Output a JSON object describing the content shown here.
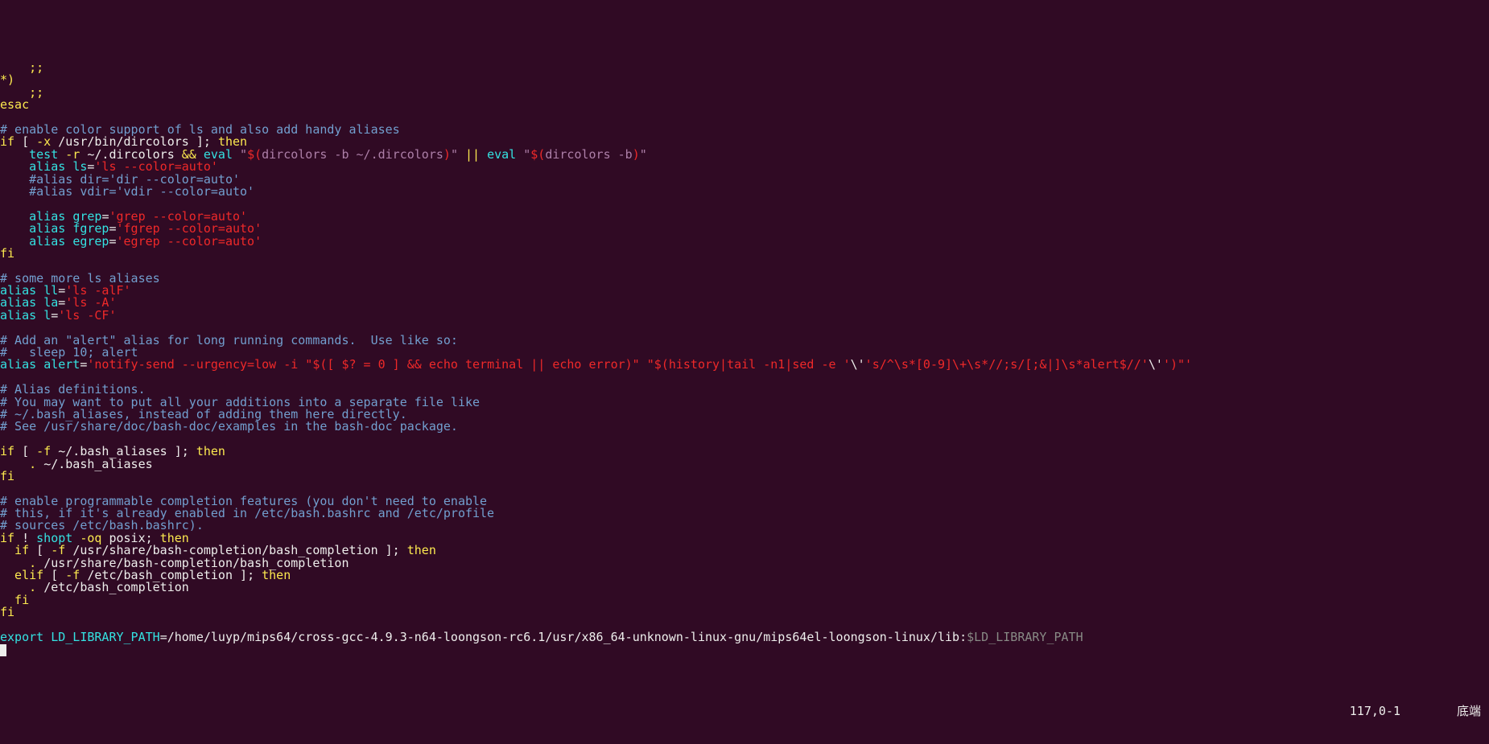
{
  "status": {
    "position": "117,0-1",
    "label": "底端"
  },
  "lines": [
    [
      {
        "t": "    ;;",
        "c": "c-kw"
      }
    ],
    [
      {
        "t": "*)",
        "c": "c-kw"
      }
    ],
    [
      {
        "t": "    ;;",
        "c": "c-kw"
      }
    ],
    [
      {
        "t": "esac",
        "c": "c-kw"
      }
    ],
    [
      {
        "t": "",
        "c": ""
      }
    ],
    [
      {
        "t": "# enable color support of ls and also add handy aliases",
        "c": "c-cmt"
      }
    ],
    [
      {
        "t": "if",
        "c": "c-kw"
      },
      {
        "t": " [ ",
        "c": "c-white"
      },
      {
        "t": "-x ",
        "c": "c-kw"
      },
      {
        "t": "/usr/bin/dircolors",
        "c": "c-white"
      },
      {
        "t": " ]",
        "c": "c-white"
      },
      {
        "t": "; ",
        "c": "c-white"
      },
      {
        "t": "then",
        "c": "c-kw"
      }
    ],
    [
      {
        "t": "    test ",
        "c": "c-cmd"
      },
      {
        "t": "-r ",
        "c": "c-kw"
      },
      {
        "t": "~/.dircolors ",
        "c": "c-white"
      },
      {
        "t": "&& ",
        "c": "c-kw"
      },
      {
        "t": "eval ",
        "c": "c-cmd"
      },
      {
        "t": "\"",
        "c": "c-str"
      },
      {
        "t": "$(",
        "c": "c-red"
      },
      {
        "t": "dircolors -b ~/.dircolors",
        "c": "c-str"
      },
      {
        "t": ")",
        "c": "c-red"
      },
      {
        "t": "\"",
        "c": "c-str"
      },
      {
        "t": " || ",
        "c": "c-kw"
      },
      {
        "t": "eval ",
        "c": "c-cmd"
      },
      {
        "t": "\"",
        "c": "c-str"
      },
      {
        "t": "$(",
        "c": "c-red"
      },
      {
        "t": "dircolors -b",
        "c": "c-str"
      },
      {
        "t": ")",
        "c": "c-red"
      },
      {
        "t": "\"",
        "c": "c-str"
      }
    ],
    [
      {
        "t": "    alias ",
        "c": "c-cmd"
      },
      {
        "t": "ls",
        "c": "c-cmd"
      },
      {
        "t": "=",
        "c": "c-white"
      },
      {
        "t": "'ls --color=auto'",
        "c": "c-red"
      }
    ],
    [
      {
        "t": "    #alias dir='dir --color=auto'",
        "c": "c-cmt"
      }
    ],
    [
      {
        "t": "    #alias vdir='vdir --color=auto'",
        "c": "c-cmt"
      }
    ],
    [
      {
        "t": "",
        "c": ""
      }
    ],
    [
      {
        "t": "    alias ",
        "c": "c-cmd"
      },
      {
        "t": "grep",
        "c": "c-cmd"
      },
      {
        "t": "=",
        "c": "c-white"
      },
      {
        "t": "'grep --color=auto'",
        "c": "c-red"
      }
    ],
    [
      {
        "t": "    alias ",
        "c": "c-cmd"
      },
      {
        "t": "fgrep",
        "c": "c-cmd"
      },
      {
        "t": "=",
        "c": "c-white"
      },
      {
        "t": "'fgrep --color=auto'",
        "c": "c-red"
      }
    ],
    [
      {
        "t": "    alias ",
        "c": "c-cmd"
      },
      {
        "t": "egrep",
        "c": "c-cmd"
      },
      {
        "t": "=",
        "c": "c-white"
      },
      {
        "t": "'egrep --color=auto'",
        "c": "c-red"
      }
    ],
    [
      {
        "t": "fi",
        "c": "c-kw"
      }
    ],
    [
      {
        "t": "",
        "c": ""
      }
    ],
    [
      {
        "t": "# some more ls aliases",
        "c": "c-cmt"
      }
    ],
    [
      {
        "t": "alias ",
        "c": "c-cmd"
      },
      {
        "t": "ll",
        "c": "c-cmd"
      },
      {
        "t": "=",
        "c": "c-white"
      },
      {
        "t": "'ls -alF'",
        "c": "c-red"
      }
    ],
    [
      {
        "t": "alias ",
        "c": "c-cmd"
      },
      {
        "t": "la",
        "c": "c-cmd"
      },
      {
        "t": "=",
        "c": "c-white"
      },
      {
        "t": "'ls -A'",
        "c": "c-red"
      }
    ],
    [
      {
        "t": "alias ",
        "c": "c-cmd"
      },
      {
        "t": "l",
        "c": "c-cmd"
      },
      {
        "t": "=",
        "c": "c-white"
      },
      {
        "t": "'ls -CF'",
        "c": "c-red"
      }
    ],
    [
      {
        "t": "",
        "c": ""
      }
    ],
    [
      {
        "t": "# Add an \"alert\" alias for long running commands.  Use like so:",
        "c": "c-cmt"
      }
    ],
    [
      {
        "t": "#   sleep 10; alert",
        "c": "c-cmt"
      }
    ],
    [
      {
        "t": "alias ",
        "c": "c-cmd"
      },
      {
        "t": "alert",
        "c": "c-cmd"
      },
      {
        "t": "=",
        "c": "c-white"
      },
      {
        "t": "'notify-send --urgency=low -i \"$([ $? = 0 ] && echo terminal || echo error)\" \"$(history|tail -n1|sed -e ",
        "c": "c-red"
      },
      {
        "t": "'",
        "c": "c-red"
      },
      {
        "t": "\\'",
        "c": "c-white"
      },
      {
        "t": "'",
        "c": "c-red"
      },
      {
        "t": "s/^\\s*[0-9]\\+\\s*//;s/[;&|]\\s*alert$//",
        "c": "c-red"
      },
      {
        "t": "'",
        "c": "c-red"
      },
      {
        "t": "\\'",
        "c": "c-white"
      },
      {
        "t": "'",
        "c": "c-red"
      },
      {
        "t": ")\"",
        "c": "c-red"
      },
      {
        "t": "'",
        "c": "c-red"
      }
    ],
    [
      {
        "t": "",
        "c": ""
      }
    ],
    [
      {
        "t": "# Alias definitions.",
        "c": "c-cmt"
      }
    ],
    [
      {
        "t": "# You may want to put all your additions into a separate file like",
        "c": "c-cmt"
      }
    ],
    [
      {
        "t": "# ~/.bash_aliases, instead of adding them here directly.",
        "c": "c-cmt"
      }
    ],
    [
      {
        "t": "# See /usr/share/doc/bash-doc/examples in the bash-doc package.",
        "c": "c-cmt"
      }
    ],
    [
      {
        "t": "",
        "c": ""
      }
    ],
    [
      {
        "t": "if",
        "c": "c-kw"
      },
      {
        "t": " [ ",
        "c": "c-white"
      },
      {
        "t": "-f ",
        "c": "c-kw"
      },
      {
        "t": "~/.bash_aliases",
        "c": "c-white"
      },
      {
        "t": " ]",
        "c": "c-white"
      },
      {
        "t": "; ",
        "c": "c-white"
      },
      {
        "t": "then",
        "c": "c-kw"
      }
    ],
    [
      {
        "t": "    . ",
        "c": "c-kw"
      },
      {
        "t": "~/.bash_aliases",
        "c": "c-white"
      }
    ],
    [
      {
        "t": "fi",
        "c": "c-kw"
      }
    ],
    [
      {
        "t": "",
        "c": ""
      }
    ],
    [
      {
        "t": "# enable programmable completion features (you don't need to enable",
        "c": "c-cmt"
      }
    ],
    [
      {
        "t": "# this, if it's already enabled in /etc/bash.bashrc and /etc/profile",
        "c": "c-cmt"
      }
    ],
    [
      {
        "t": "# sources /etc/bash.bashrc).",
        "c": "c-cmt"
      }
    ],
    [
      {
        "t": "if",
        "c": "c-kw"
      },
      {
        "t": " ! ",
        "c": "c-white"
      },
      {
        "t": "shopt ",
        "c": "c-cmd"
      },
      {
        "t": "-oq ",
        "c": "c-kw"
      },
      {
        "t": "posix",
        "c": "c-white"
      },
      {
        "t": "; ",
        "c": "c-white"
      },
      {
        "t": "then",
        "c": "c-kw"
      }
    ],
    [
      {
        "t": "  if",
        "c": "c-kw"
      },
      {
        "t": " [ ",
        "c": "c-white"
      },
      {
        "t": "-f ",
        "c": "c-kw"
      },
      {
        "t": "/usr/share/bash-completion/bash_completion",
        "c": "c-white"
      },
      {
        "t": " ]",
        "c": "c-white"
      },
      {
        "t": "; ",
        "c": "c-white"
      },
      {
        "t": "then",
        "c": "c-kw"
      }
    ],
    [
      {
        "t": "    . ",
        "c": "c-kw"
      },
      {
        "t": "/usr/share/bash-completion/bash_completion",
        "c": "c-white"
      }
    ],
    [
      {
        "t": "  elif",
        "c": "c-kw"
      },
      {
        "t": " [ ",
        "c": "c-white"
      },
      {
        "t": "-f ",
        "c": "c-kw"
      },
      {
        "t": "/etc/bash_completion",
        "c": "c-white"
      },
      {
        "t": " ]",
        "c": "c-white"
      },
      {
        "t": "; ",
        "c": "c-white"
      },
      {
        "t": "then",
        "c": "c-kw"
      }
    ],
    [
      {
        "t": "    . ",
        "c": "c-kw"
      },
      {
        "t": "/etc/bash_completion",
        "c": "c-white"
      }
    ],
    [
      {
        "t": "  fi",
        "c": "c-kw"
      }
    ],
    [
      {
        "t": "fi",
        "c": "c-kw"
      }
    ],
    [
      {
        "t": "",
        "c": ""
      }
    ],
    [
      {
        "t": "export ",
        "c": "c-cmd"
      },
      {
        "t": "LD_LIBRARY_PATH",
        "c": "c-cmd"
      },
      {
        "t": "=",
        "c": "c-white"
      },
      {
        "t": "/home/luyp/mips64/cross-gcc-4.9.3-n64-loongson-rc6.1/usr/x86_64-unknown-linux-gnu/mips64el-loongson-linux/lib:",
        "c": "c-white"
      },
      {
        "t": "$LD_LIBRARY_PATH",
        "c": "c-grey"
      }
    ]
  ]
}
